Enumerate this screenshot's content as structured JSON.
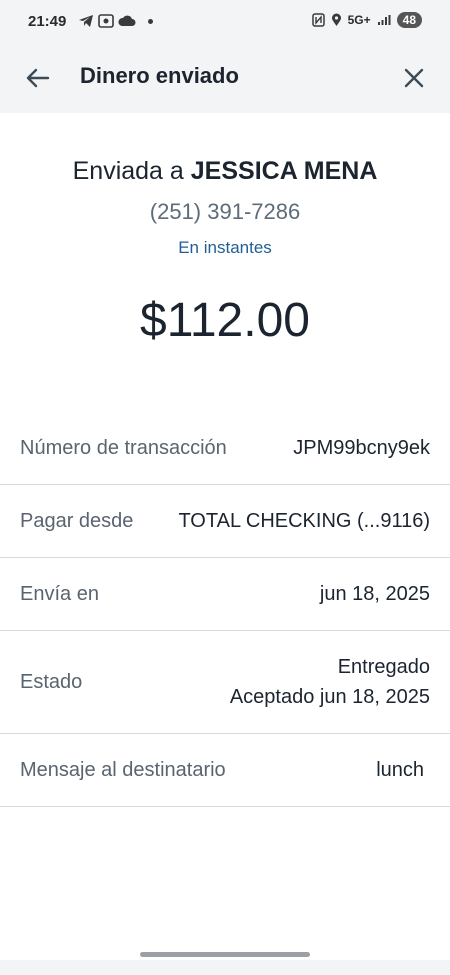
{
  "status_bar": {
    "time": "21:49",
    "network": "5G+",
    "battery": "48"
  },
  "app_bar": {
    "title": "Dinero enviado"
  },
  "transfer": {
    "sent_prefix": "Enviada a",
    "recipient": "JESSICA MENA",
    "phone": "(251) 391-7286",
    "timing": "En instantes",
    "amount": "$112.00"
  },
  "details": {
    "transaction_label": "Número de transacción",
    "transaction_value": "JPM99bcny9ek",
    "pay_from_label": "Pagar desde",
    "pay_from_value": "TOTAL CHECKING (...9116)",
    "send_on_label": "Envía en",
    "send_on_value": "jun 18, 2025",
    "status_label": "Estado",
    "status_value_1": "Entregado",
    "status_value_2": "Aceptado jun 18, 2025",
    "message_label": "Mensaje al destinatario",
    "message_value": "lunch"
  },
  "colors": {
    "accent_link": "#1f5f96",
    "text_primary": "#1c2430",
    "text_secondary": "#5a6470",
    "divider": "#d6d9dd"
  }
}
